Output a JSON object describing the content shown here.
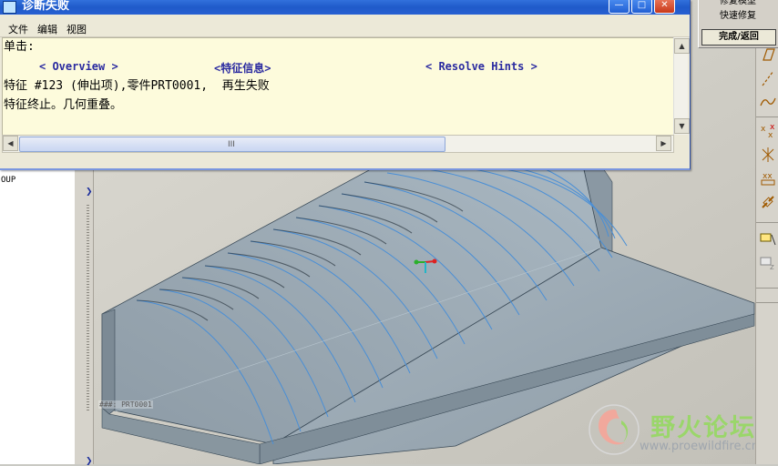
{
  "dialog": {
    "title": "诊断失败",
    "menu": [
      "文件",
      "编辑",
      "视图"
    ],
    "click_label": "单击:",
    "links": [
      "< Overview >",
      "<特征信息>",
      "< Resolve Hints >"
    ],
    "line1": "特征 #123 (伸出项),零件PRT0001,  再生失败",
    "line2": "特征终止。几何重叠。",
    "scroll_grip": "III"
  },
  "menu_manager": {
    "items": [
      "修复模型",
      "快速修复",
      "完成/返回"
    ]
  },
  "model_tree": {
    "item": "OUP"
  },
  "viewport": {
    "model_label": "###: PRT0001"
  },
  "watermark": {
    "site_name": "野火论坛",
    "url": "www.proewildfire.cn"
  },
  "colors": {
    "title_bar": "#2760d2",
    "dialog_bg": "#ece9d8",
    "content_bg": "#fdfbdc",
    "model_fill": "#97a8b4",
    "model_edge": "#3a4a57",
    "spline_blue": "#4a8fd6",
    "link_blue": "#2a2aa0"
  }
}
